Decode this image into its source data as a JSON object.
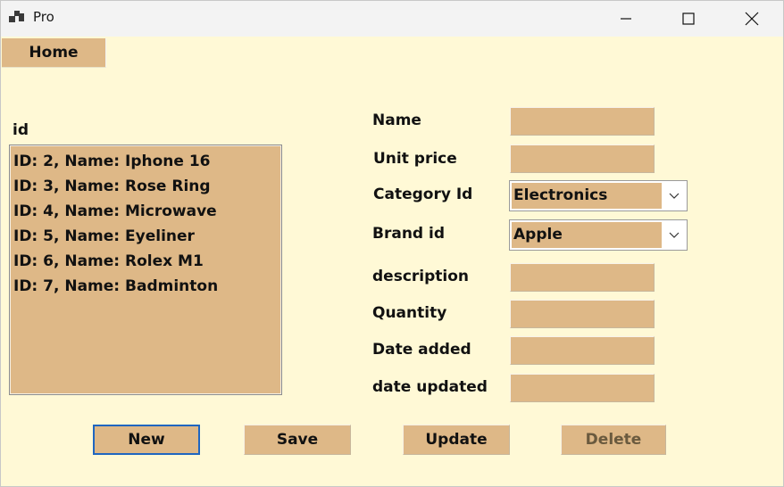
{
  "window": {
    "title": "Pro"
  },
  "menu": {
    "home_label": "Home"
  },
  "list": {
    "label": "id",
    "items": [
      "ID: 2, Name: Iphone 16",
      "ID: 3, Name: Rose Ring",
      "ID: 4, Name: Microwave",
      "ID: 5, Name: Eyeliner",
      "ID: 6, Name: Rolex M1",
      "ID: 7, Name: Badminton"
    ]
  },
  "form": {
    "name": {
      "label": "Name",
      "value": ""
    },
    "unit_price": {
      "label": "Unit price",
      "value": ""
    },
    "category": {
      "label": "Category Id",
      "value": "Electronics"
    },
    "brand": {
      "label": "Brand id",
      "value": "Apple"
    },
    "description": {
      "label": "description",
      "value": ""
    },
    "quantity": {
      "label": "Quantity",
      "value": ""
    },
    "date_added": {
      "label": "Date added",
      "value": ""
    },
    "date_updated": {
      "label": "date updated",
      "value": ""
    }
  },
  "buttons": {
    "new_label": "New",
    "save_label": "Save",
    "update_label": "Update",
    "delete_label": "Delete"
  },
  "colors": {
    "background": "#fff9d6",
    "control": "#deb887",
    "focus": "#1f66c0"
  },
  "icons": {
    "app": "app-icon",
    "minimize": "minimize-icon",
    "maximize": "maximize-icon",
    "close": "close-icon",
    "dropdown": "chevron-down-icon"
  }
}
